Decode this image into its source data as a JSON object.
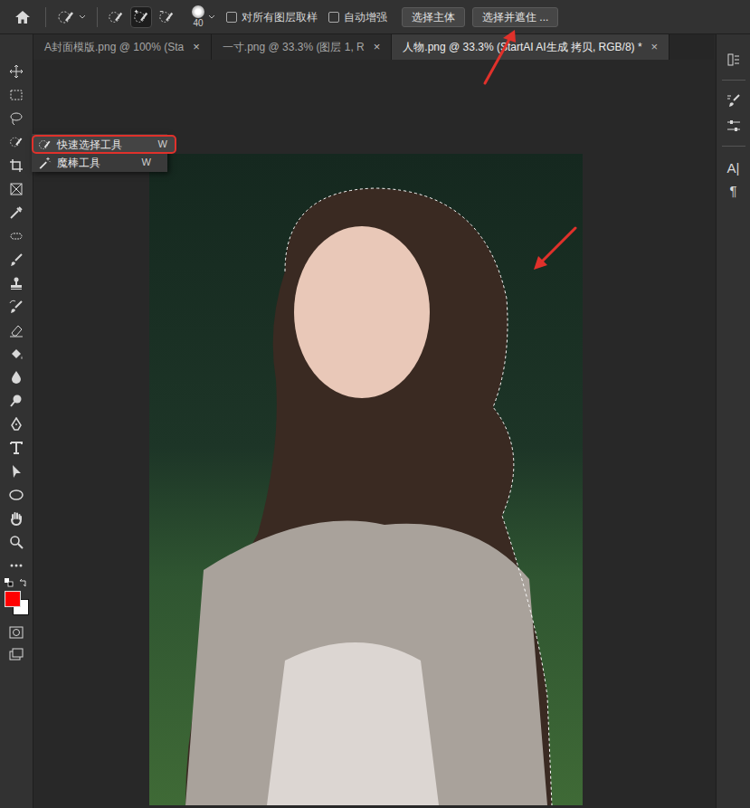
{
  "options_bar": {
    "brush_size": "40",
    "tool_modes": [
      {
        "selected": false
      },
      {
        "selected": true
      },
      {
        "selected": false
      }
    ],
    "checkboxes": [
      {
        "label": "对所有图层取样",
        "checked": false
      },
      {
        "label": "自动增强",
        "checked": false
      }
    ],
    "buttons": [
      "选择主体",
      "选择并遮住 ..."
    ]
  },
  "tabs": [
    {
      "label": "A封面模版.png @ 100% (Sta",
      "close": "×",
      "selected": false
    },
    {
      "label": "一寸.png @ 33.3% (图层 1, R",
      "close": "×",
      "selected": false
    },
    {
      "label": "人物.png @ 33.3% (StartAI AI生成 拷贝, RGB/8) *",
      "close": "×",
      "selected": true
    }
  ],
  "tool_flyout": {
    "items": [
      {
        "label": "快速选择工具",
        "shortcut": "W",
        "selected": true
      },
      {
        "label": "魔棒工具",
        "shortcut": "W",
        "selected": false
      }
    ]
  },
  "colors": {
    "foreground": "#ff0000",
    "background": "#ffffff"
  },
  "right_panel": {
    "glyphs": [
      "A|",
      "¶"
    ]
  }
}
